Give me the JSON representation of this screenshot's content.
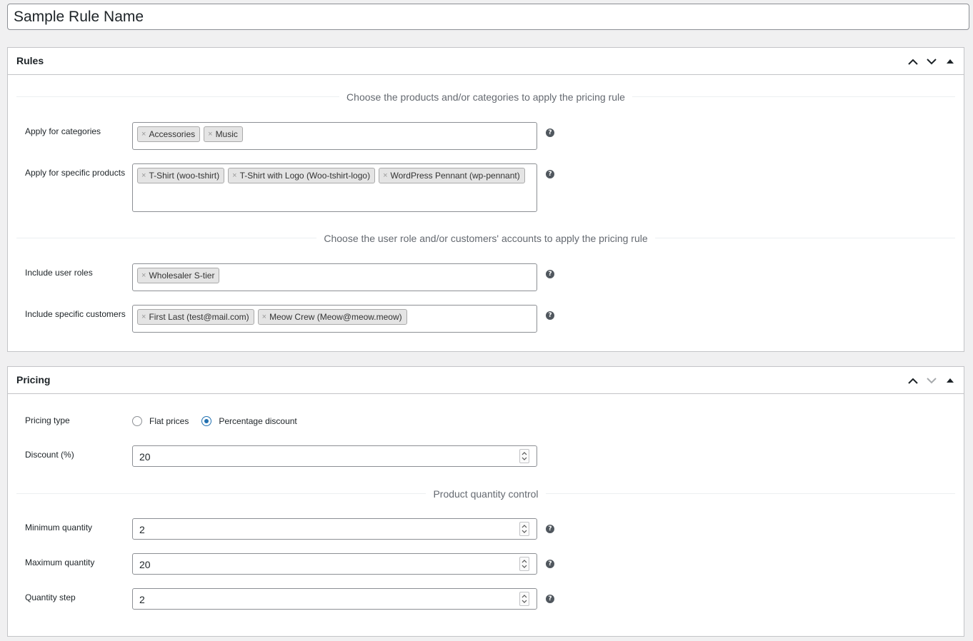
{
  "rule_name": "Sample Rule Name",
  "rules_box": {
    "title": "Rules",
    "section1": "Choose the products and/or categories to apply the pricing rule",
    "section2": "Choose the user role and/or customers' accounts to apply the pricing rule",
    "categories": {
      "label": "Apply for categories",
      "chips": [
        "Accessories",
        "Music"
      ]
    },
    "products": {
      "label": "Apply for specific products",
      "chips": [
        "T-Shirt (woo-tshirt)",
        "T-Shirt with Logo (Woo-tshirt-logo)",
        "WordPress Pennant (wp-pennant)"
      ]
    },
    "roles": {
      "label": "Include user roles",
      "chips": [
        "Wholesaler S-tier"
      ]
    },
    "customers": {
      "label": "Include specific customers",
      "chips": [
        "First Last (test@mail.com)",
        "Meow Crew (Meow@meow.meow)"
      ]
    }
  },
  "pricing_box": {
    "title": "Pricing",
    "pricing_type": {
      "label": "Pricing type",
      "options": [
        "Flat prices",
        "Percentage discount"
      ],
      "selected": "Percentage discount"
    },
    "discount": {
      "label": "Discount (%)",
      "value": "20"
    },
    "quantity_section": "Product quantity control",
    "min_qty": {
      "label": "Minimum quantity",
      "value": "2"
    },
    "max_qty": {
      "label": "Maximum quantity",
      "value": "20"
    },
    "qty_step": {
      "label": "Quantity step",
      "value": "2"
    }
  },
  "chip_remove": "×",
  "help_glyph": "?",
  "colors": {
    "accent": "#2271b1",
    "border": "#c3c4c7",
    "background": "#f0f0f1"
  }
}
